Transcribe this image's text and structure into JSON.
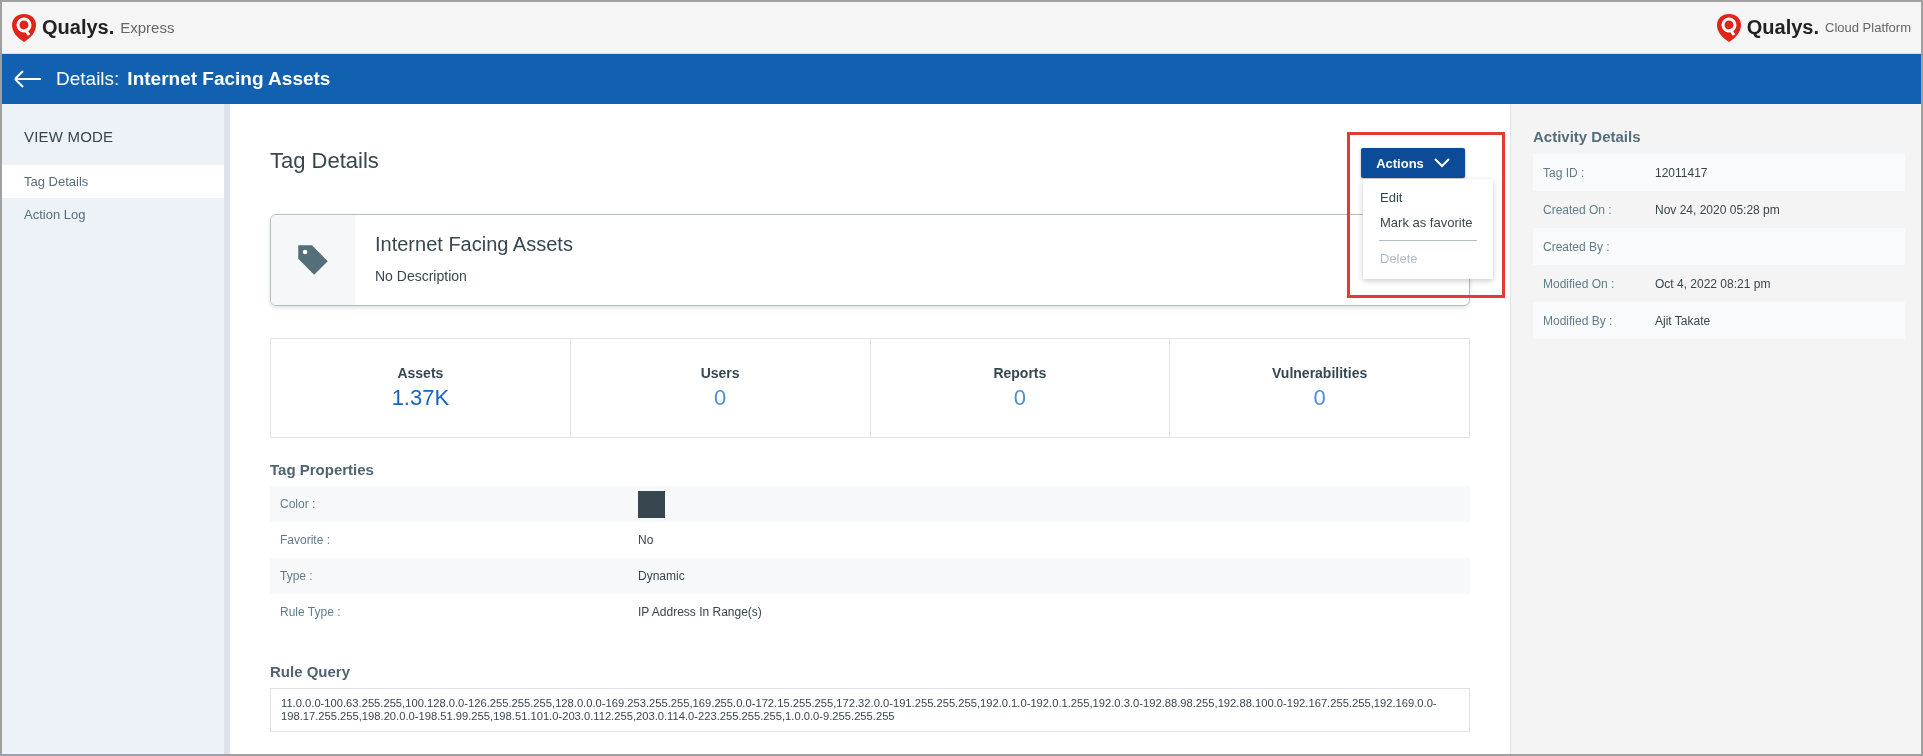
{
  "app": {
    "left_brand": "Qualys.",
    "left_product": "Express",
    "right_brand": "Qualys.",
    "right_product": "Cloud Platform"
  },
  "page_header": {
    "label": "Details:",
    "title": "Internet Facing Assets"
  },
  "sidebar": {
    "heading": "VIEW MODE",
    "items": [
      {
        "label": "Tag Details",
        "selected": true
      },
      {
        "label": "Action Log",
        "selected": false
      }
    ]
  },
  "main": {
    "title": "Tag Details",
    "actions": {
      "label": "Actions",
      "expanded": true,
      "highlighted": true,
      "menu": [
        {
          "kind": "item",
          "label": "Edit",
          "disabled": false
        },
        {
          "kind": "item",
          "label": "Mark as favorite",
          "disabled": false
        },
        {
          "kind": "divider"
        },
        {
          "kind": "item",
          "label": "Delete",
          "disabled": true
        }
      ]
    },
    "tag": {
      "name": "Internet Facing Assets",
      "description": "No Description"
    },
    "stats": [
      {
        "label": "Assets",
        "value": "1.37K"
      },
      {
        "label": "Users",
        "value": "0"
      },
      {
        "label": "Reports",
        "value": "0"
      },
      {
        "label": "Vulnerabilities",
        "value": "0"
      }
    ],
    "properties": {
      "heading": "Tag Properties",
      "rows": [
        {
          "kind": "color",
          "label": "Color :",
          "color": "#37474f"
        },
        {
          "kind": "text",
          "label": "Favorite :",
          "value": "No"
        },
        {
          "kind": "text",
          "label": "Type :",
          "value": "Dynamic"
        },
        {
          "kind": "text",
          "label": "Rule Type :",
          "value": "IP Address In Range(s)"
        }
      ]
    },
    "rule_query": {
      "heading": "Rule Query",
      "value": "11.0.0.0-100.63.255.255,100.128.0.0-126.255.255.255,128.0.0.0-169.253.255.255,169.255.0.0-172.15.255.255,172.32.0.0-191.255.255.255,192.0.1.0-192.0.1.255,192.0.3.0-192.88.98.255,192.88.100.0-192.167.255.255,192.169.0.0-198.17.255.255,198.20.0.0-198.51.99.255,198.51.101.0-203.0.112.255,203.0.114.0-223.255.255.255,1.0.0.0-9.255.255.255"
    }
  },
  "activity": {
    "heading": "Activity Details",
    "rows": [
      {
        "label": "Tag ID :",
        "value": "12011417"
      },
      {
        "label": "Created On :",
        "value": "Nov 24, 2020 05:28 pm"
      },
      {
        "label": "Created By :",
        "value": ""
      },
      {
        "label": "Modified On :",
        "value": "Oct 4, 2022 08:21 pm"
      },
      {
        "label": "Modified By :",
        "value": "Ajit Takate"
      }
    ]
  }
}
